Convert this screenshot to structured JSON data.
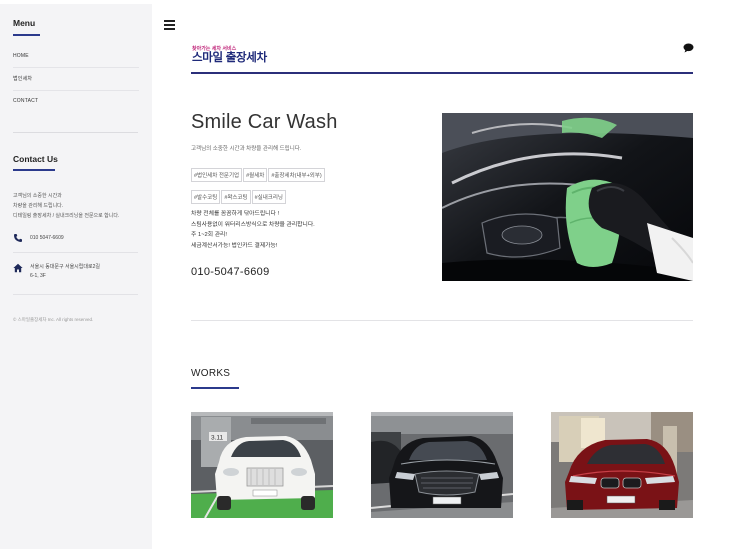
{
  "sidebar": {
    "menu_title": "Menu",
    "menu_items": [
      {
        "label": "HOME"
      },
      {
        "label": "법인세차"
      },
      {
        "label": "CONTACT"
      }
    ],
    "contact_title": "Contact Us",
    "contact_desc": [
      "고객님의 소중한 시간과",
      "차량을 관리해 드립니다.",
      "디테일링 출장세차 / 실내크리닝을 전문으로 합니다."
    ],
    "phone": "010 5047-6609",
    "address": [
      "서울시 동대문구 서울시립대로2길",
      "6-1, 3F"
    ],
    "copyright": "© 스마일출장세차 Inc. All rights reserved."
  },
  "header": {
    "logo_small": "찾아가는 세차 서비스",
    "logo_big": "스마일 출장세차",
    "menu_icon": "hamburger-icon",
    "chat_icon": "chat-bubble-icon"
  },
  "hero": {
    "title": "Smile Car Wash",
    "subtitle": "고객님의 소중한 시간과 차량을 관리해 드립니다.",
    "tags": [
      "#법인세차 전문기업",
      "#월세차",
      "#출장세차(내부+외부)",
      "#발수코팅",
      "#왁스코팅",
      "#실내크리닝"
    ],
    "body": [
      "차량 전체를 꼼꼼하게 닦아드립니다 !",
      "스팀사용없이 워터리스방식으로 차량을 관리합니다.",
      "주 1~2회 관리!",
      "세금계산서가능! 법인카드 결제가능!"
    ],
    "phone": "010-5047-6609"
  },
  "works": {
    "title": "WORKS",
    "items": [
      {
        "car": "white-suv",
        "badge": "3.11"
      },
      {
        "car": "black-suv"
      },
      {
        "car": "red-suv"
      }
    ]
  },
  "colors": {
    "accent": "#2b3a8c",
    "sidebar_bg": "#f4f4f6",
    "logo_pink": "#c0267a",
    "logo_navy": "#1f2a7a"
  }
}
